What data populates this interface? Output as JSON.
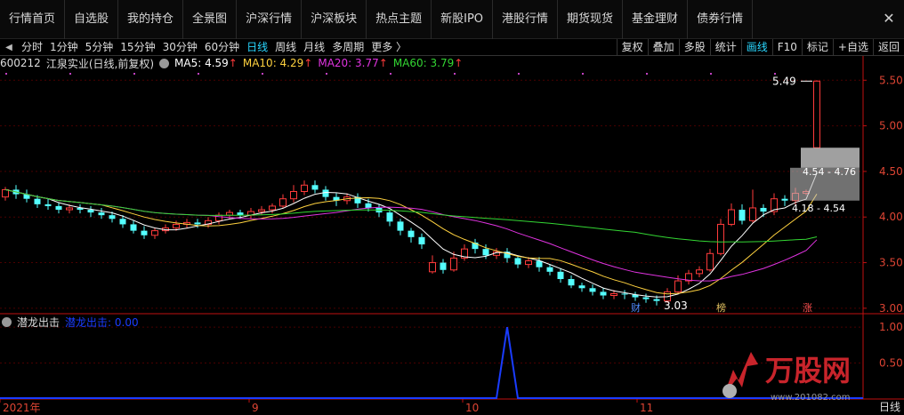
{
  "nav": {
    "tabs": [
      "行情首页",
      "自选股",
      "我的持仓",
      "全景图",
      "沪深行情",
      "沪深板块",
      "热点主题",
      "新股IPO",
      "港股行情",
      "期货现货",
      "基金理财",
      "债券行情"
    ],
    "close_label": "✕"
  },
  "periods": {
    "items": [
      "分时",
      "1分钟",
      "5分钟",
      "15分钟",
      "30分钟",
      "60分钟",
      "日线",
      "周线",
      "月线",
      "多周期",
      "更多 〉"
    ],
    "active_index": 6
  },
  "toolbar_right": {
    "items": [
      "复权",
      "叠加",
      "多股",
      "统计",
      "画线",
      "F10",
      "标记",
      "+自选",
      "返回"
    ],
    "active_index": 4
  },
  "stock": {
    "code": "600212",
    "name": "江泉实业",
    "mode": "(日线,前复权)",
    "ma5": "MA5: 4.59",
    "ma10": "MA10: 4.29",
    "ma20": "MA20: 3.77",
    "ma60": "MA60: 3.79",
    "up_arrow": "↑"
  },
  "colors": {
    "up": "#ff3b3b",
    "down": "#54ffff",
    "ma5": "#ffffff",
    "ma10": "#ffd23f",
    "ma20": "#e033e0",
    "ma60": "#33d633",
    "axis": "#c01010",
    "grid": "#4a0000",
    "indicator": "#1a3cff"
  },
  "chart_data": {
    "type": "candlestick",
    "y_ticks": [
      "5.50",
      "5.00",
      "4.50",
      "4.00",
      "3.50",
      "3.00"
    ],
    "ylim": [
      2.95,
      5.6
    ],
    "x_labels": [
      "2021年",
      "9",
      "10",
      "11"
    ],
    "annotations": {
      "high": "5.49",
      "low": "3.03",
      "range1": "4.54 - 4.76",
      "range2": "4.18 - 4.54"
    },
    "event_markers": [
      "财",
      "榜",
      "涨"
    ],
    "candles": [
      [
        4.22,
        4.3,
        4.33,
        4.18
      ],
      [
        4.3,
        4.25,
        4.35,
        4.2
      ],
      [
        4.25,
        4.2,
        4.3,
        4.16
      ],
      [
        4.2,
        4.14,
        4.24,
        4.1
      ],
      [
        4.14,
        4.12,
        4.2,
        4.08
      ],
      [
        4.12,
        4.08,
        4.16,
        4.04
      ],
      [
        4.08,
        4.1,
        4.14,
        4.04
      ],
      [
        4.1,
        4.08,
        4.14,
        4.04
      ],
      [
        4.08,
        4.05,
        4.12,
        4.0
      ],
      [
        4.05,
        4.02,
        4.1,
        3.98
      ],
      [
        4.02,
        3.98,
        4.06,
        3.94
      ],
      [
        3.98,
        3.92,
        4.02,
        3.88
      ],
      [
        3.92,
        3.85,
        3.96,
        3.82
      ],
      [
        3.85,
        3.8,
        3.9,
        3.76
      ],
      [
        3.8,
        3.85,
        3.88,
        3.76
      ],
      [
        3.85,
        3.88,
        3.92,
        3.82
      ],
      [
        3.88,
        3.92,
        3.96,
        3.85
      ],
      [
        3.92,
        3.94,
        3.98,
        3.88
      ],
      [
        3.94,
        3.92,
        3.98,
        3.88
      ],
      [
        3.92,
        3.96,
        4.0,
        3.88
      ],
      [
        3.96,
        4.02,
        4.05,
        3.92
      ],
      [
        4.02,
        4.05,
        4.08,
        3.98
      ],
      [
        4.05,
        4.02,
        4.08,
        3.98
      ],
      [
        4.02,
        4.06,
        4.1,
        3.98
      ],
      [
        4.06,
        4.08,
        4.12,
        4.02
      ],
      [
        4.08,
        4.12,
        4.15,
        4.04
      ],
      [
        4.12,
        4.2,
        4.25,
        4.1
      ],
      [
        4.2,
        4.28,
        4.35,
        4.16
      ],
      [
        4.28,
        4.35,
        4.4,
        4.24
      ],
      [
        4.35,
        4.3,
        4.4,
        4.26
      ],
      [
        4.3,
        4.22,
        4.34,
        4.18
      ],
      [
        4.22,
        4.18,
        4.26,
        4.12
      ],
      [
        4.18,
        4.22,
        4.26,
        4.14
      ],
      [
        4.22,
        4.15,
        4.26,
        4.1
      ],
      [
        4.15,
        4.1,
        4.2,
        4.06
      ],
      [
        4.1,
        4.05,
        4.14,
        4.0
      ],
      [
        4.05,
        3.95,
        4.08,
        3.9
      ],
      [
        3.95,
        3.85,
        3.98,
        3.8
      ],
      [
        3.85,
        3.78,
        3.88,
        3.72
      ],
      [
        3.78,
        3.7,
        3.82,
        3.65
      ],
      [
        3.4,
        3.5,
        3.58,
        3.38
      ],
      [
        3.5,
        3.42,
        3.54,
        3.38
      ],
      [
        3.42,
        3.55,
        3.62,
        3.4
      ],
      [
        3.55,
        3.65,
        3.7,
        3.52
      ],
      [
        3.72,
        3.65,
        3.76,
        3.6
      ],
      [
        3.65,
        3.58,
        3.7,
        3.54
      ],
      [
        3.58,
        3.62,
        3.66,
        3.54
      ],
      [
        3.62,
        3.55,
        3.66,
        3.5
      ],
      [
        3.55,
        3.48,
        3.58,
        3.44
      ],
      [
        3.48,
        3.52,
        3.56,
        3.44
      ],
      [
        3.52,
        3.45,
        3.56,
        3.4
      ],
      [
        3.45,
        3.4,
        3.48,
        3.36
      ],
      [
        3.4,
        3.32,
        3.44,
        3.28
      ],
      [
        3.32,
        3.25,
        3.36,
        3.22
      ],
      [
        3.25,
        3.22,
        3.28,
        3.18
      ],
      [
        3.22,
        3.18,
        3.26,
        3.14
      ],
      [
        3.18,
        3.14,
        3.22,
        3.1
      ],
      [
        3.14,
        3.16,
        3.2,
        3.1
      ],
      [
        3.16,
        3.15,
        3.2,
        3.1
      ],
      [
        3.15,
        3.12,
        3.18,
        3.08
      ],
      [
        3.12,
        3.1,
        3.16,
        3.06
      ],
      [
        3.1,
        3.08,
        3.14,
        3.03
      ],
      [
        3.08,
        3.18,
        3.22,
        3.06
      ],
      [
        3.18,
        3.3,
        3.36,
        3.16
      ],
      [
        3.3,
        3.38,
        3.42,
        3.26
      ],
      [
        3.38,
        3.42,
        3.46,
        3.34
      ],
      [
        3.42,
        3.6,
        3.65,
        3.4
      ],
      [
        3.6,
        3.92,
        3.98,
        3.58
      ],
      [
        3.92,
        4.08,
        4.15,
        3.9
      ],
      [
        4.08,
        3.96,
        4.14,
        3.92
      ],
      [
        3.96,
        4.1,
        4.3,
        3.94
      ],
      [
        4.1,
        4.06,
        4.14,
        4.0
      ],
      [
        4.06,
        4.2,
        4.26,
        4.02
      ],
      [
        4.2,
        4.18,
        4.24,
        4.12
      ],
      [
        4.18,
        4.26,
        4.32,
        4.14
      ],
      [
        4.26,
        4.28,
        4.3,
        4.24
      ],
      [
        4.76,
        5.49,
        5.5,
        4.76
      ]
    ],
    "indicator": {
      "name": "潜龙出击",
      "label": "潜龙出击: 0.00",
      "y_ticks": [
        "1.00",
        "0.50"
      ],
      "ylim": [
        0,
        1.1
      ],
      "spike_index": 47,
      "spike_value": 1.0
    }
  },
  "watermark": {
    "text": "万股网",
    "url": "www.201082.com"
  },
  "bottom_period": "日线"
}
